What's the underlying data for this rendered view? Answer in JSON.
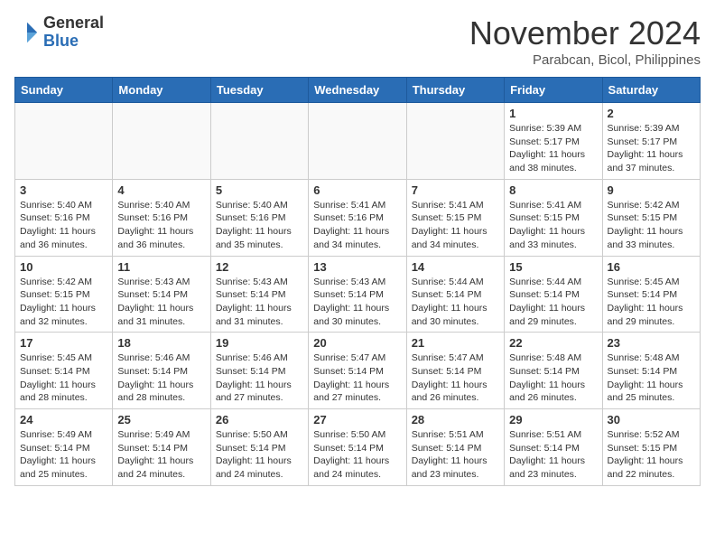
{
  "header": {
    "logo": {
      "line1": "General",
      "line2": "Blue"
    },
    "month": "November 2024",
    "location": "Parabcan, Bicol, Philippines"
  },
  "weekdays": [
    "Sunday",
    "Monday",
    "Tuesday",
    "Wednesday",
    "Thursday",
    "Friday",
    "Saturday"
  ],
  "weeks": [
    [
      {
        "day": "",
        "info": ""
      },
      {
        "day": "",
        "info": ""
      },
      {
        "day": "",
        "info": ""
      },
      {
        "day": "",
        "info": ""
      },
      {
        "day": "",
        "info": ""
      },
      {
        "day": "1",
        "info": "Sunrise: 5:39 AM\nSunset: 5:17 PM\nDaylight: 11 hours\nand 38 minutes."
      },
      {
        "day": "2",
        "info": "Sunrise: 5:39 AM\nSunset: 5:17 PM\nDaylight: 11 hours\nand 37 minutes."
      }
    ],
    [
      {
        "day": "3",
        "info": "Sunrise: 5:40 AM\nSunset: 5:16 PM\nDaylight: 11 hours\nand 36 minutes."
      },
      {
        "day": "4",
        "info": "Sunrise: 5:40 AM\nSunset: 5:16 PM\nDaylight: 11 hours\nand 36 minutes."
      },
      {
        "day": "5",
        "info": "Sunrise: 5:40 AM\nSunset: 5:16 PM\nDaylight: 11 hours\nand 35 minutes."
      },
      {
        "day": "6",
        "info": "Sunrise: 5:41 AM\nSunset: 5:16 PM\nDaylight: 11 hours\nand 34 minutes."
      },
      {
        "day": "7",
        "info": "Sunrise: 5:41 AM\nSunset: 5:15 PM\nDaylight: 11 hours\nand 34 minutes."
      },
      {
        "day": "8",
        "info": "Sunrise: 5:41 AM\nSunset: 5:15 PM\nDaylight: 11 hours\nand 33 minutes."
      },
      {
        "day": "9",
        "info": "Sunrise: 5:42 AM\nSunset: 5:15 PM\nDaylight: 11 hours\nand 33 minutes."
      }
    ],
    [
      {
        "day": "10",
        "info": "Sunrise: 5:42 AM\nSunset: 5:15 PM\nDaylight: 11 hours\nand 32 minutes."
      },
      {
        "day": "11",
        "info": "Sunrise: 5:43 AM\nSunset: 5:14 PM\nDaylight: 11 hours\nand 31 minutes."
      },
      {
        "day": "12",
        "info": "Sunrise: 5:43 AM\nSunset: 5:14 PM\nDaylight: 11 hours\nand 31 minutes."
      },
      {
        "day": "13",
        "info": "Sunrise: 5:43 AM\nSunset: 5:14 PM\nDaylight: 11 hours\nand 30 minutes."
      },
      {
        "day": "14",
        "info": "Sunrise: 5:44 AM\nSunset: 5:14 PM\nDaylight: 11 hours\nand 30 minutes."
      },
      {
        "day": "15",
        "info": "Sunrise: 5:44 AM\nSunset: 5:14 PM\nDaylight: 11 hours\nand 29 minutes."
      },
      {
        "day": "16",
        "info": "Sunrise: 5:45 AM\nSunset: 5:14 PM\nDaylight: 11 hours\nand 29 minutes."
      }
    ],
    [
      {
        "day": "17",
        "info": "Sunrise: 5:45 AM\nSunset: 5:14 PM\nDaylight: 11 hours\nand 28 minutes."
      },
      {
        "day": "18",
        "info": "Sunrise: 5:46 AM\nSunset: 5:14 PM\nDaylight: 11 hours\nand 28 minutes."
      },
      {
        "day": "19",
        "info": "Sunrise: 5:46 AM\nSunset: 5:14 PM\nDaylight: 11 hours\nand 27 minutes."
      },
      {
        "day": "20",
        "info": "Sunrise: 5:47 AM\nSunset: 5:14 PM\nDaylight: 11 hours\nand 27 minutes."
      },
      {
        "day": "21",
        "info": "Sunrise: 5:47 AM\nSunset: 5:14 PM\nDaylight: 11 hours\nand 26 minutes."
      },
      {
        "day": "22",
        "info": "Sunrise: 5:48 AM\nSunset: 5:14 PM\nDaylight: 11 hours\nand 26 minutes."
      },
      {
        "day": "23",
        "info": "Sunrise: 5:48 AM\nSunset: 5:14 PM\nDaylight: 11 hours\nand 25 minutes."
      }
    ],
    [
      {
        "day": "24",
        "info": "Sunrise: 5:49 AM\nSunset: 5:14 PM\nDaylight: 11 hours\nand 25 minutes."
      },
      {
        "day": "25",
        "info": "Sunrise: 5:49 AM\nSunset: 5:14 PM\nDaylight: 11 hours\nand 24 minutes."
      },
      {
        "day": "26",
        "info": "Sunrise: 5:50 AM\nSunset: 5:14 PM\nDaylight: 11 hours\nand 24 minutes."
      },
      {
        "day": "27",
        "info": "Sunrise: 5:50 AM\nSunset: 5:14 PM\nDaylight: 11 hours\nand 24 minutes."
      },
      {
        "day": "28",
        "info": "Sunrise: 5:51 AM\nSunset: 5:14 PM\nDaylight: 11 hours\nand 23 minutes."
      },
      {
        "day": "29",
        "info": "Sunrise: 5:51 AM\nSunset: 5:14 PM\nDaylight: 11 hours\nand 23 minutes."
      },
      {
        "day": "30",
        "info": "Sunrise: 5:52 AM\nSunset: 5:15 PM\nDaylight: 11 hours\nand 22 minutes."
      }
    ]
  ]
}
